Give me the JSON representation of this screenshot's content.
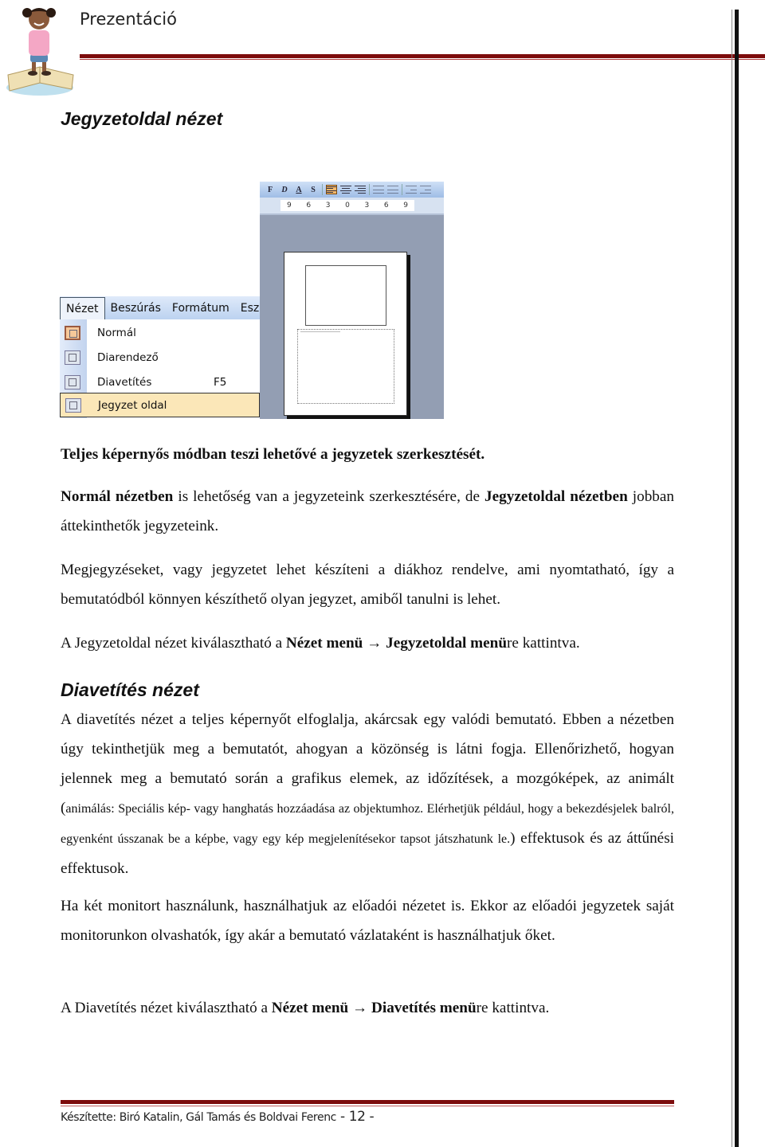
{
  "header": {
    "title": "Prezentáció",
    "logo": "cartoon-girl-on-book-logo"
  },
  "section1": {
    "title": "Jegyzetoldal nézet"
  },
  "editor_screenshot": {
    "toolbar_buttons": [
      "F",
      "D",
      "A",
      "S"
    ],
    "toolbar_icons": [
      "align-left-icon",
      "align-center-icon",
      "align-right-icon",
      "numbered-list-icon",
      "bullet-list-icon",
      "decrease-indent-icon",
      "increase-indent-icon"
    ],
    "ruler_ticks": [
      "9",
      "6",
      "3",
      "0",
      "3",
      "6",
      "9"
    ]
  },
  "menu_screenshot": {
    "menubar": [
      "Nézet",
      "Beszúrás",
      "Formátum",
      "Esz"
    ],
    "items": [
      {
        "label": "Normál",
        "shortcut": "",
        "icon": "normal-view-icon"
      },
      {
        "label": "Diarendező",
        "shortcut": "",
        "icon": "slide-sorter-icon"
      },
      {
        "label": "Diavetítés",
        "shortcut": "F5",
        "icon": "slideshow-icon"
      },
      {
        "label": "Jegyzet oldal",
        "shortcut": "",
        "icon": "notes-page-icon"
      }
    ]
  },
  "paragraphs": {
    "p1": "Teljes képernyős módban teszi lehetővé a jegyzetek szerkesztését.",
    "p2": {
      "b1": "Normál nézetben",
      "t1": " is lehetőség van a jegyzeteink szerkesztésére, de ",
      "b2": "Jegyzetoldal nézetben",
      "t2": " jobban áttekinthetők jegyzeteink."
    },
    "p3": "Megjegyzéseket, vagy jegyzetet lehet készíteni a diákhoz rendelve, ami nyomtatható, így a bemutatódból könnyen készíthető olyan jegyzet, amiből tanulni is lehet.",
    "p4": {
      "t1": "A Jegyzetoldal nézet kiválasztható a ",
      "b1": "Nézet menü",
      "arrow": " → ",
      "b2": "Jegyzetoldal menü",
      "t2": "re kattintva."
    }
  },
  "section2": {
    "title": "Diavetítés nézet",
    "p5": {
      "t1": "A diavetítés nézet a teljes képernyőt elfoglalja, akárcsak egy valódi bemutató. Ebben a nézetben úgy tekinthetjük meg a bemutatót, ahogyan a közönség is látni fogja. Ellenőrizhető, hogyan jelennek meg a bemutató során a grafikus elemek, az időzítések, a mozgóképek, az animált (",
      "small": "animálás: Speciális kép- vagy hanghatás hozzáadása az objektumhoz. Elérhetjük például, hogy a bekezdésjelek balról, egyenként ússzanak be a képbe, vagy egy kép megjelenítésekor tapsot játszhatunk le.",
      "t2": ") effektusok és az áttűnési effektusok."
    },
    "p6": "Ha két monitort használunk, használhatjuk az előadói nézetet is. Ekkor az előadói jegyzetek saját monitorunkon olvashatók, így akár a bemutató vázlataként is használhatjuk őket.",
    "p7": {
      "t1": "A Diavetítés nézet kiválasztható a ",
      "b1": "Nézet menü",
      "arrow": " → ",
      "b2": "Diavetítés menü",
      "t2": "re kattintva."
    }
  },
  "footer": {
    "text": "Készítette: Biró Katalin, Gál Tamás és Boldvai Ferenc",
    "page": " - 12 -"
  },
  "colors": {
    "rule": "#7d0c0c",
    "menu_highlight": "#fbe7b8",
    "editor_bg": "#939eb3"
  }
}
